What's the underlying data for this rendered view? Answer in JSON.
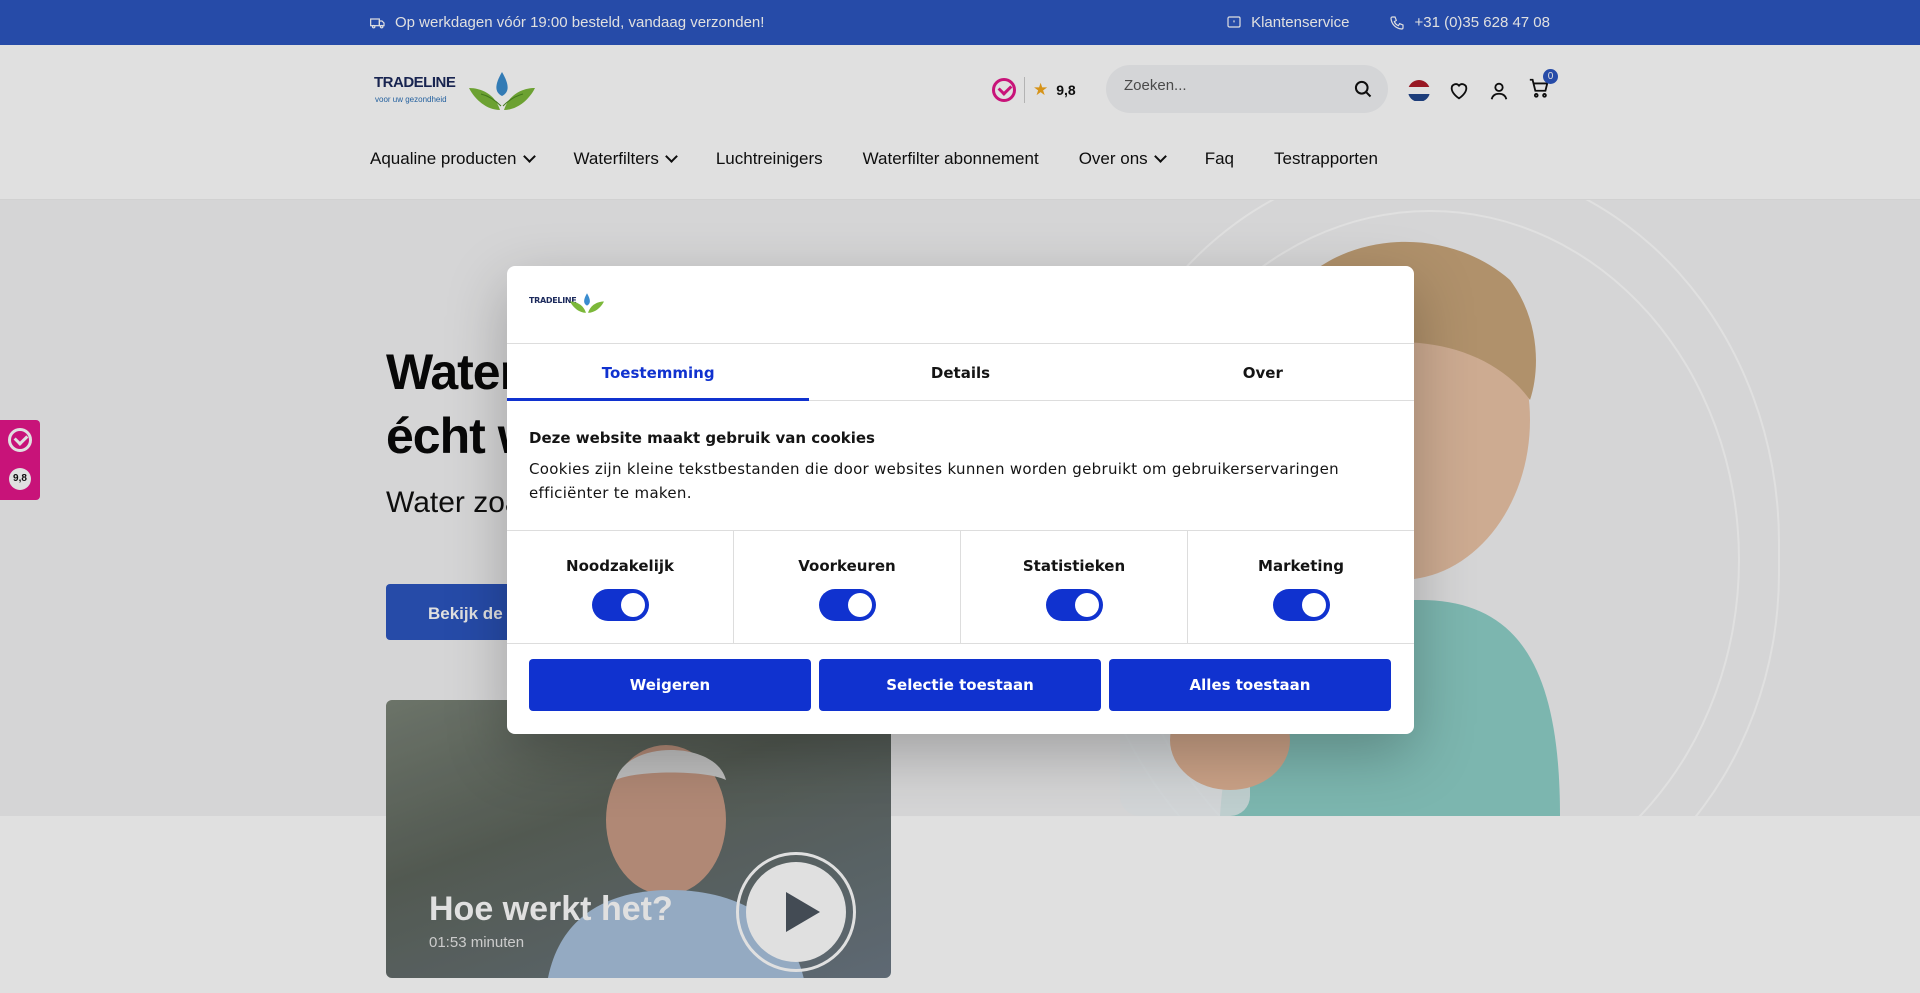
{
  "topbar": {
    "shipping_text": "Op werkdagen vóór 19:00 besteld, vandaag verzonden!",
    "service_label": "Klantenservice",
    "phone": "+31 (0)35 628 47 08"
  },
  "header": {
    "logo_text": "TRADELINE",
    "logo_tagline": "voor uw gezondheid",
    "rating": "9,8",
    "search_placeholder": "Zoeken...",
    "cart_count": "0"
  },
  "nav": {
    "items": [
      {
        "label": "Aqualine producten",
        "dropdown": true
      },
      {
        "label": "Waterfilters",
        "dropdown": true
      },
      {
        "label": "Luchtreinigers",
        "dropdown": false
      },
      {
        "label": "Waterfilter abonnement",
        "dropdown": false
      },
      {
        "label": "Over ons",
        "dropdown": true
      },
      {
        "label": "Faq",
        "dropdown": false
      },
      {
        "label": "Testrapporten",
        "dropdown": false
      }
    ]
  },
  "hero": {
    "title_line1": "Water",
    "title_line2": "écht w",
    "subtitle": "Water zoa",
    "cta_label": "Bekijk de A"
  },
  "video": {
    "title": "Hoe werkt het?",
    "duration": "01:53 minuten"
  },
  "side_badge": {
    "score": "9,8"
  },
  "cookie_dialog": {
    "logo_text": "TRADELINE",
    "tabs": [
      "Toestemming",
      "Details",
      "Over"
    ],
    "active_tab": "Toestemming",
    "heading": "Deze website maakt gebruik van cookies",
    "text": "Cookies zijn kleine tekstbestanden die door websites kunnen worden gebruikt om gebruikerservaringen efficiënter te maken.",
    "preferences": [
      {
        "label": "Noodzakelijk",
        "enabled": true
      },
      {
        "label": "Voorkeuren",
        "enabled": true
      },
      {
        "label": "Statistieken",
        "enabled": true
      },
      {
        "label": "Marketing",
        "enabled": true
      }
    ],
    "buttons": {
      "reject": "Weigeren",
      "allow_selection": "Selectie toestaan",
      "allow_all": "Alles toestaan"
    }
  },
  "colors": {
    "brand_blue": "#2c56c0",
    "dialog_blue": "#1032cf",
    "kiyoh_pink": "#e4168a"
  }
}
